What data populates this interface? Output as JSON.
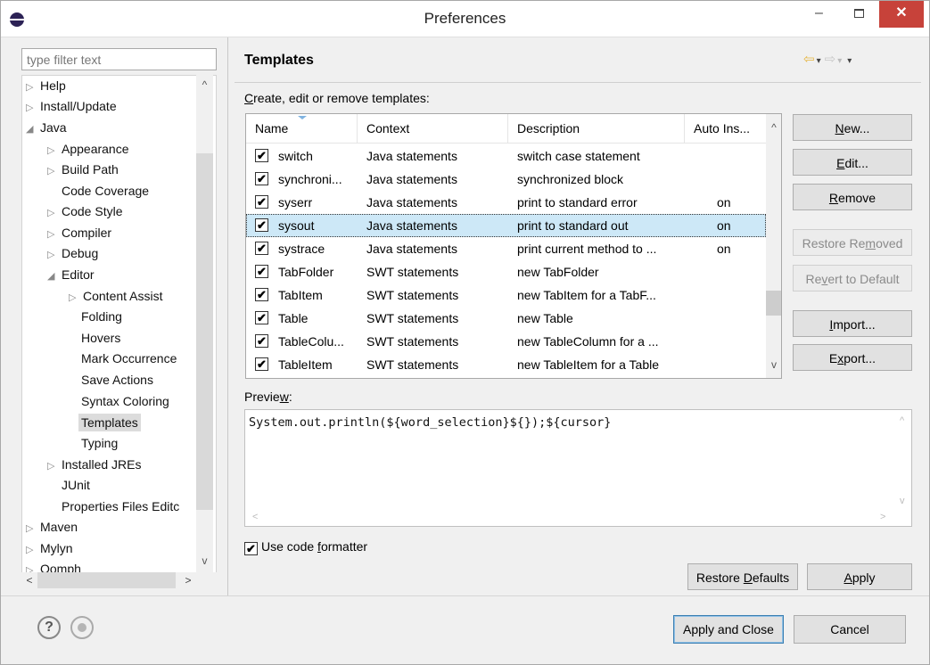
{
  "window": {
    "title": "Preferences",
    "minimize_glyph": "–",
    "close_glyph": "✕"
  },
  "filter": {
    "placeholder": "type filter text"
  },
  "tree": {
    "items": [
      {
        "label": "Help",
        "expander": "▷"
      },
      {
        "label": "Install/Update",
        "expander": "▷"
      },
      {
        "label": "Java",
        "expander": "◢"
      },
      {
        "label": "Appearance",
        "expander": "▷"
      },
      {
        "label": "Build Path",
        "expander": "▷"
      },
      {
        "label": "Code Coverage",
        "expander": ""
      },
      {
        "label": "Code Style",
        "expander": "▷"
      },
      {
        "label": "Compiler",
        "expander": "▷"
      },
      {
        "label": "Debug",
        "expander": "▷"
      },
      {
        "label": "Editor",
        "expander": "◢"
      },
      {
        "label": "Content Assist",
        "expander": "▷"
      },
      {
        "label": "Folding",
        "expander": ""
      },
      {
        "label": "Hovers",
        "expander": ""
      },
      {
        "label": "Mark Occurrence",
        "expander": ""
      },
      {
        "label": "Save Actions",
        "expander": ""
      },
      {
        "label": "Syntax Coloring",
        "expander": ""
      },
      {
        "label": "Templates",
        "expander": ""
      },
      {
        "label": "Typing",
        "expander": ""
      },
      {
        "label": "Installed JREs",
        "expander": "▷"
      },
      {
        "label": "JUnit",
        "expander": ""
      },
      {
        "label": "Properties Files Editc",
        "expander": ""
      },
      {
        "label": "Maven",
        "expander": "▷"
      },
      {
        "label": "Mylyn",
        "expander": "▷"
      },
      {
        "label": "Oomph",
        "expander": "▷"
      }
    ],
    "scroll_up": "^",
    "scroll_down": "v",
    "scroll_left": "<",
    "scroll_right": ">"
  },
  "page": {
    "title": "Templates",
    "section_label_pre": "C",
    "section_label_rest": "reate, edit or remove templates:",
    "nav_back": "⇦",
    "nav_fwd": "⇨",
    "nav_dropdown": "▾"
  },
  "table": {
    "columns": [
      "Name",
      "Context",
      "Description",
      "Auto Ins..."
    ],
    "check": "✔",
    "rows": [
      {
        "name": "switch",
        "context": "Java statements",
        "description": "switch case statement",
        "auto": ""
      },
      {
        "name": "synchroni...",
        "context": "Java statements",
        "description": "synchronized block",
        "auto": ""
      },
      {
        "name": "syserr",
        "context": "Java statements",
        "description": "print to standard error",
        "auto": "on"
      },
      {
        "name": "sysout",
        "context": "Java statements",
        "description": "print to standard out",
        "auto": "on"
      },
      {
        "name": "systrace",
        "context": "Java statements",
        "description": "print current method to ...",
        "auto": "on"
      },
      {
        "name": "TabFolder",
        "context": "SWT statements",
        "description": "new TabFolder",
        "auto": ""
      },
      {
        "name": "TabItem",
        "context": "SWT statements",
        "description": "new TabItem for a TabF...",
        "auto": ""
      },
      {
        "name": "Table",
        "context": "SWT statements",
        "description": "new Table",
        "auto": ""
      },
      {
        "name": "TableColu...",
        "context": "SWT statements",
        "description": "new TableColumn for a ...",
        "auto": ""
      },
      {
        "name": "TableItem",
        "context": "SWT statements",
        "description": "new TableItem for a Table",
        "auto": ""
      }
    ],
    "scroll_up": "^",
    "scroll_down": "v"
  },
  "buttons": {
    "new": {
      "pre": "",
      "u": "N",
      "post": "ew..."
    },
    "edit": {
      "pre": "",
      "u": "E",
      "post": "dit..."
    },
    "remove": {
      "pre": "",
      "u": "R",
      "post": "emove"
    },
    "restore_removed": {
      "pre": "Restore Re",
      "u": "m",
      "post": "oved"
    },
    "revert_default": {
      "pre": "Re",
      "u": "v",
      "post": "ert to Default"
    },
    "import": {
      "pre": "",
      "u": "I",
      "post": "mport..."
    },
    "export": {
      "pre": "E",
      "u": "x",
      "post": "port..."
    },
    "restore_defaults": {
      "pre": "Restore ",
      "u": "D",
      "post": "efaults"
    },
    "apply": {
      "pre": "",
      "u": "A",
      "post": "pply"
    },
    "apply_close": "Apply and Close",
    "cancel": "Cancel"
  },
  "preview": {
    "label_pre": "Previe",
    "label_u": "w",
    "label_post": ":",
    "code": "System.out.println(${word_selection}${});${cursor}",
    "scroll_up": "^",
    "scroll_down": "v",
    "scroll_left": "<",
    "scroll_right": ">"
  },
  "formatter": {
    "check": "✔",
    "label_pre": "Use code ",
    "label_u": "f",
    "label_post": "ormatter"
  },
  "footer": {
    "help_glyph": "?"
  },
  "colors": {
    "selection": "#cde8f7",
    "close_button": "#c7423a",
    "nav_back": "#e5b642"
  }
}
